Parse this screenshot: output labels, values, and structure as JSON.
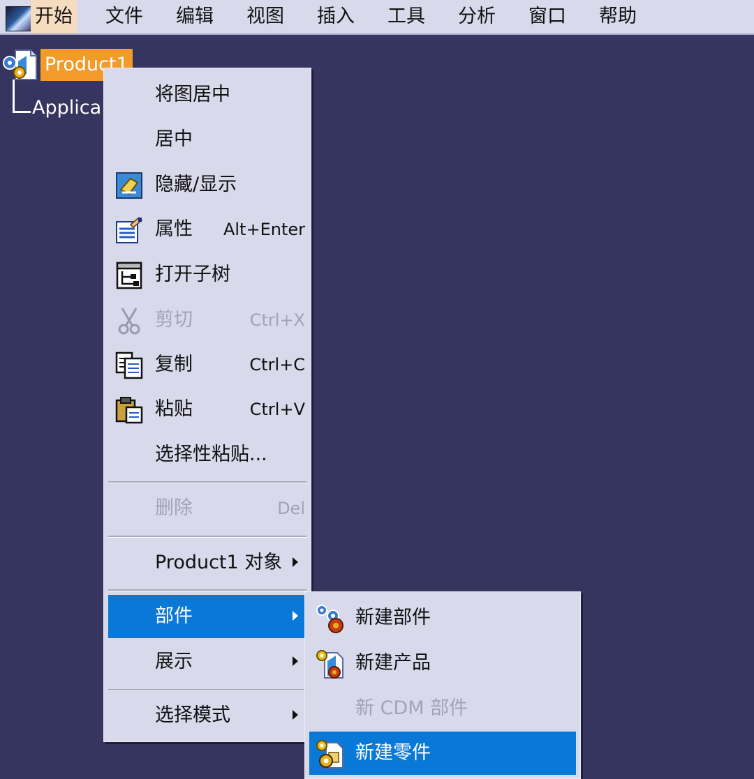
{
  "menubar": {
    "items": [
      "开始",
      "文件",
      "编辑",
      "视图",
      "插入",
      "工具",
      "分析",
      "窗口",
      "帮助"
    ]
  },
  "tree": {
    "root_label": "Product1",
    "child_label": "Applica"
  },
  "context_menu": {
    "items": [
      {
        "label": "将图居中",
        "shortcut": ""
      },
      {
        "label": "居中",
        "shortcut": ""
      },
      {
        "label": "隐藏/显示",
        "shortcut": "",
        "icon": "hide-show-icon"
      },
      {
        "label": "属性",
        "shortcut": "Alt+Enter",
        "icon": "properties-icon"
      },
      {
        "label": "打开子树",
        "shortcut": "",
        "icon": "subtree-icon"
      },
      {
        "label": "剪切",
        "shortcut": "Ctrl+X",
        "icon": "scissors-icon",
        "disabled": true
      },
      {
        "label": "复制",
        "shortcut": "Ctrl+C",
        "icon": "copy-icon"
      },
      {
        "label": "粘贴",
        "shortcut": "Ctrl+V",
        "icon": "paste-icon"
      },
      {
        "label": "选择性粘贴...",
        "shortcut": ""
      },
      {
        "label": "删除",
        "shortcut": "Del",
        "disabled": true
      },
      {
        "label": "Product1 对象",
        "submenu": true
      },
      {
        "label": "部件",
        "submenu": true,
        "highlighted": true
      },
      {
        "label": "展示",
        "submenu": true
      },
      {
        "label": "选择模式",
        "submenu": true
      }
    ]
  },
  "submenu": {
    "items": [
      {
        "label": "新建部件",
        "icon": "new-component-icon"
      },
      {
        "label": "新建产品",
        "icon": "new-product-icon"
      },
      {
        "label": "新 CDM 部件",
        "disabled": true
      },
      {
        "label": "新建零件",
        "icon": "new-part-icon",
        "highlighted": true
      }
    ]
  },
  "colors": {
    "background": "#36355f",
    "menu_bg": "#d9d9ec",
    "highlight": "#0a78d6",
    "selected_tree": "#f39a2a"
  }
}
